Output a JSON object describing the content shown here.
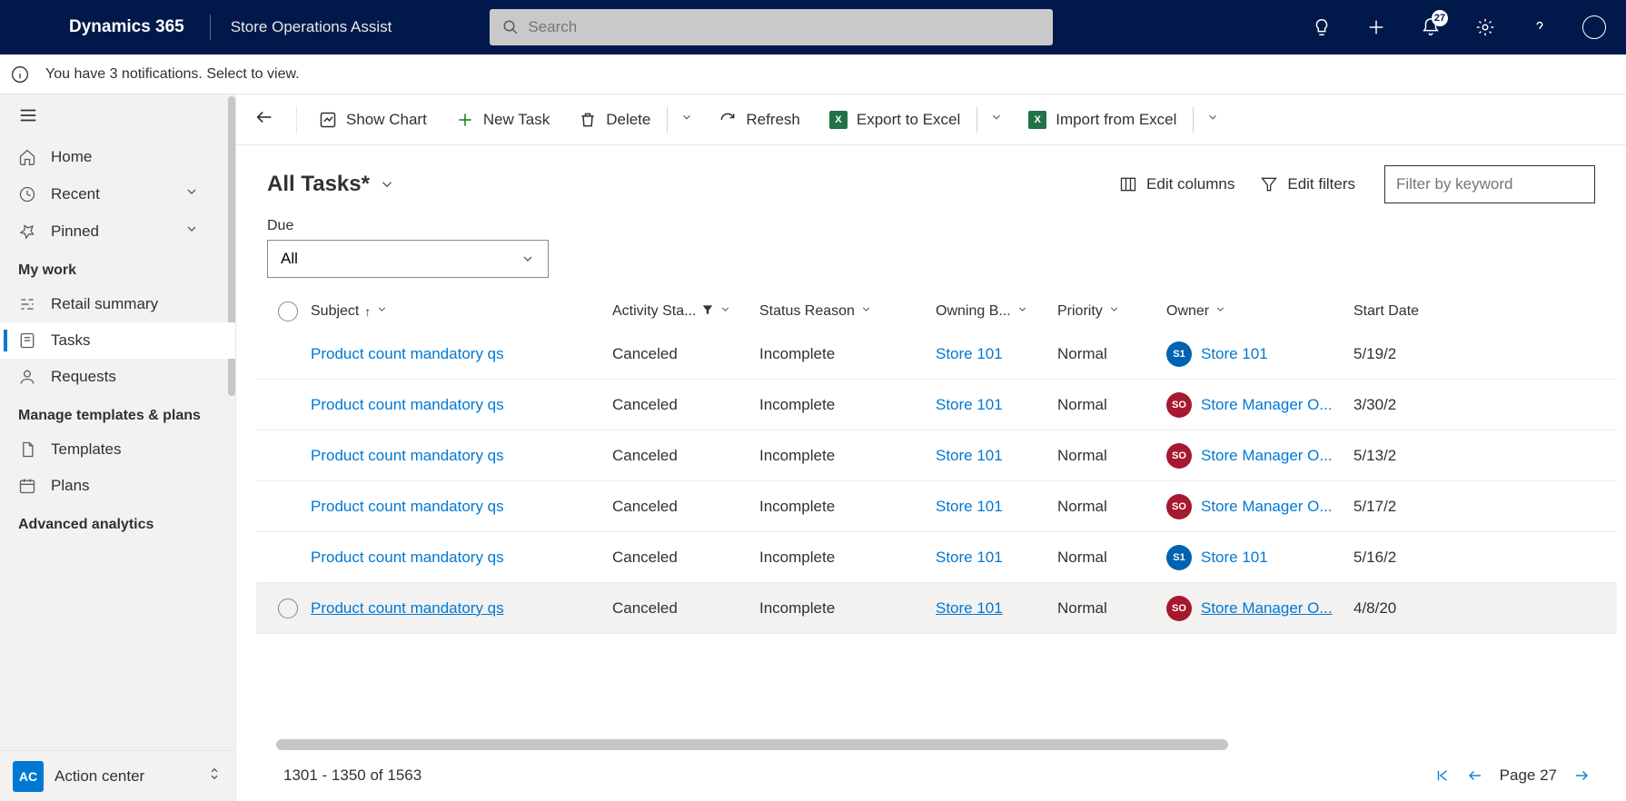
{
  "header": {
    "brand": "Dynamics 365",
    "app": "Store Operations Assist",
    "search_placeholder": "Search",
    "notification_count": "27"
  },
  "notif_bar": "You have 3 notifications. Select to view.",
  "sidebar": {
    "items": [
      {
        "label": "Home",
        "icon": "home"
      },
      {
        "label": "Recent",
        "icon": "clock",
        "chev": true
      },
      {
        "label": "Pinned",
        "icon": "pin",
        "chev": true
      }
    ],
    "sections": [
      {
        "title": "My work",
        "items": [
          {
            "label": "Retail summary",
            "icon": "bars"
          },
          {
            "label": "Tasks",
            "icon": "task",
            "active": true
          },
          {
            "label": "Requests",
            "icon": "person"
          }
        ]
      },
      {
        "title": "Manage templates & plans",
        "items": [
          {
            "label": "Templates",
            "icon": "doc"
          },
          {
            "label": "Plans",
            "icon": "calendar"
          }
        ]
      },
      {
        "title": "Advanced analytics",
        "items": []
      }
    ],
    "action_center": {
      "badge": "AC",
      "label": "Action center"
    }
  },
  "cmdbar": {
    "show_chart": "Show Chart",
    "new_task": "New Task",
    "delete": "Delete",
    "refresh": "Refresh",
    "export": "Export to Excel",
    "import": "Import from Excel"
  },
  "view": {
    "title": "All Tasks*",
    "edit_columns": "Edit columns",
    "edit_filters": "Edit filters",
    "filter_placeholder": "Filter by keyword",
    "due_label": "Due",
    "due_value": "All"
  },
  "grid": {
    "columns": {
      "subject": "Subject",
      "activity": "Activity Sta...",
      "reason": "Status Reason",
      "owning": "Owning B...",
      "priority": "Priority",
      "owner": "Owner",
      "start": "Start Date"
    },
    "rows": [
      {
        "subject": "Product count mandatory qs",
        "activity": "Canceled",
        "reason": "Incomplete",
        "owning": "Store 101",
        "priority": "Normal",
        "owner": {
          "name": "Store 101",
          "avatar": "S1",
          "color": "blue"
        },
        "start": "5/19/2"
      },
      {
        "subject": "Product count mandatory qs",
        "activity": "Canceled",
        "reason": "Incomplete",
        "owning": "Store 101",
        "priority": "Normal",
        "owner": {
          "name": "Store Manager O...",
          "avatar": "SO",
          "color": "red"
        },
        "start": "3/30/2"
      },
      {
        "subject": "Product count mandatory qs",
        "activity": "Canceled",
        "reason": "Incomplete",
        "owning": "Store 101",
        "priority": "Normal",
        "owner": {
          "name": "Store Manager O...",
          "avatar": "SO",
          "color": "red"
        },
        "start": "5/13/2"
      },
      {
        "subject": "Product count mandatory qs",
        "activity": "Canceled",
        "reason": "Incomplete",
        "owning": "Store 101",
        "priority": "Normal",
        "owner": {
          "name": "Store Manager O...",
          "avatar": "SO",
          "color": "red"
        },
        "start": "5/17/2"
      },
      {
        "subject": "Product count mandatory qs",
        "activity": "Canceled",
        "reason": "Incomplete",
        "owning": "Store 101",
        "priority": "Normal",
        "owner": {
          "name": "Store 101",
          "avatar": "S1",
          "color": "blue"
        },
        "start": "5/16/2"
      },
      {
        "subject": "Product count mandatory qs",
        "activity": "Canceled",
        "reason": "Incomplete",
        "owning": "Store 101",
        "priority": "Normal",
        "owner": {
          "name": "Store Manager O...",
          "avatar": "SO",
          "color": "red"
        },
        "start": "4/8/20",
        "hover": true
      }
    ],
    "footer": {
      "count": "1301 - 1350 of 1563",
      "page": "Page 27"
    }
  }
}
